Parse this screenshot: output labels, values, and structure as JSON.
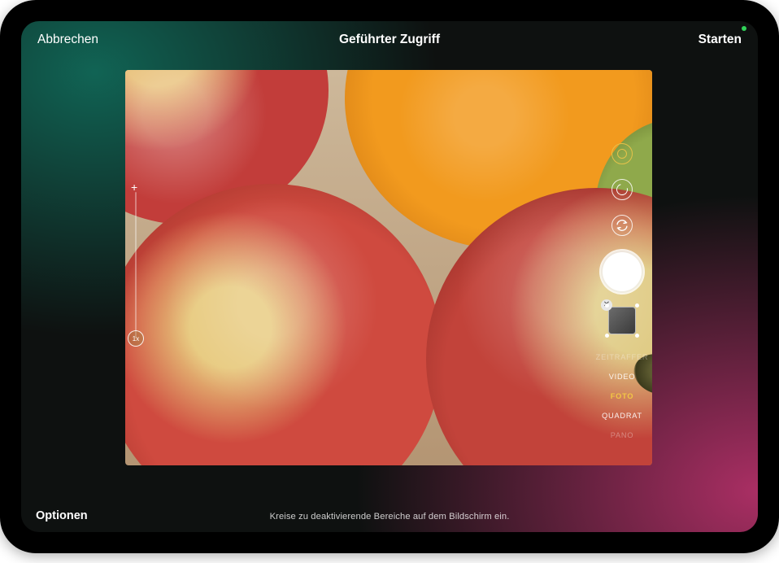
{
  "nav": {
    "cancel": "Abbrechen",
    "title": "Geführter Zugriff",
    "start": "Starten"
  },
  "footer": {
    "options": "Optionen",
    "hint": "Kreise zu deaktivierende Bereiche auf dem Bildschirm ein."
  },
  "camera": {
    "zoom": "1x",
    "modes": {
      "pre": "ZEITRAFFER",
      "video": "VIDEO",
      "photo": "FOTO",
      "square": "QUADRAT",
      "post": "PANO"
    }
  }
}
